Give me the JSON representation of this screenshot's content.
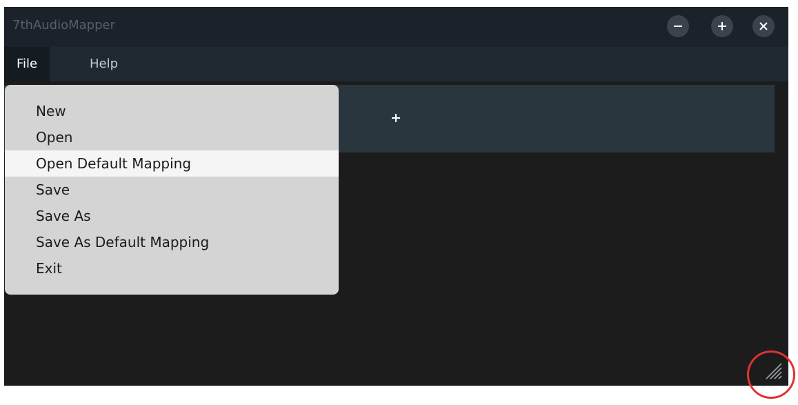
{
  "window": {
    "title": "7thAudioMapper"
  },
  "menubar": {
    "items": [
      {
        "label": "File"
      },
      {
        "label": "Help"
      }
    ]
  },
  "file_menu": {
    "items": [
      {
        "label": "New"
      },
      {
        "label": "Open"
      },
      {
        "label": "Open Default Mapping"
      },
      {
        "label": "Save"
      },
      {
        "label": "Save As"
      },
      {
        "label": "Save As Default Mapping"
      },
      {
        "label": "Exit"
      }
    ],
    "hovered_item": "Open Default Mapping"
  },
  "toolbar": {
    "add_icon": "plus-icon"
  },
  "colors": {
    "window_bg": "#1c1c1c",
    "titlebar_bg": "#1b2229",
    "menubar_bg": "#1f2932",
    "dropdown_bg": "#d4d4d4",
    "highlight": "#e03232"
  }
}
